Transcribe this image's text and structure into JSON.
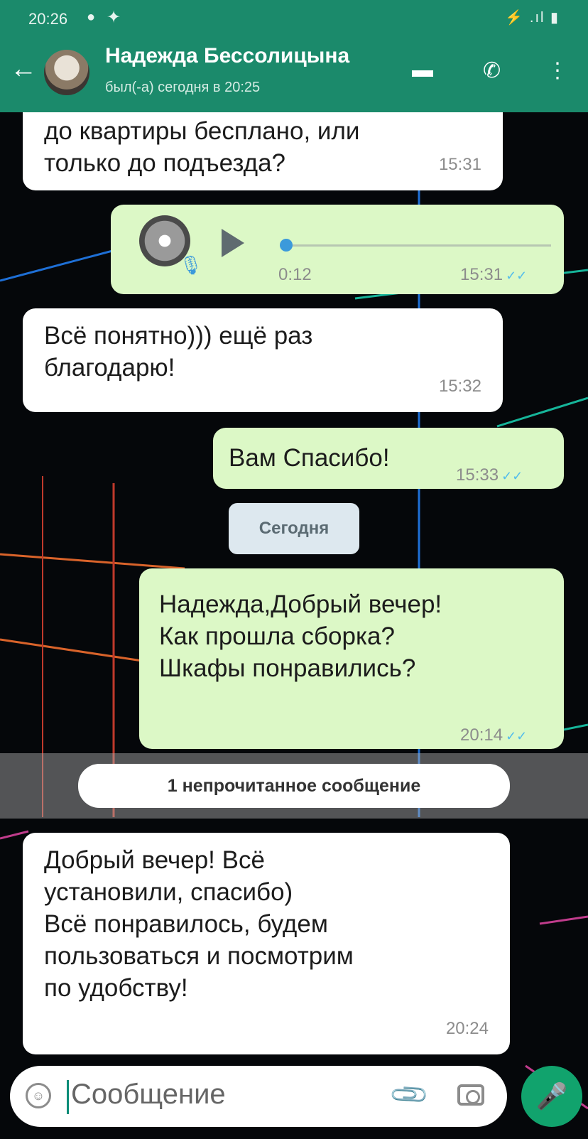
{
  "status_bar": {
    "time": "20:26",
    "icons": "⚡ .ıl ▮"
  },
  "header": {
    "contact_name": "Надежда Бессолицына",
    "last_seen": "был(-а) сегодня в 20:25",
    "back_icon": "arrow-left-icon",
    "video_icon": "video-camera-icon",
    "call_icon": "phone-icon",
    "menu_icon": "kebab-menu-icon",
    "accent_color": "#1b8a6b"
  },
  "messages": [
    {
      "direction": "in",
      "text": "до квартиры бесплано, или\nтолько до подъезда?",
      "time": "15:31"
    },
    {
      "direction": "out",
      "type": "voice",
      "duration": "0:12",
      "time": "15:31",
      "ticks": "✓✓"
    },
    {
      "direction": "in",
      "text": "Всё понятно))) ещё раз\nблагодарю!",
      "time": "15:32"
    },
    {
      "direction": "out",
      "text": "Вам Спасибо!",
      "time": "15:33",
      "ticks": "✓✓"
    },
    {
      "direction": "out",
      "text": "Надежда,Добрый вечер!\nКак прошла сборка?\nШкафы понравились?",
      "time": "20:14",
      "ticks": "✓✓"
    },
    {
      "direction": "in",
      "text": "Добрый вечер! Всё\nустановили, спасибо)\nВсё понравилось, будем\nпользоваться и посмотрим\nпо удобству!",
      "time": "20:24"
    }
  ],
  "date_chip": "Сегодня",
  "unread_label": "1 непрочитанное сообщение",
  "input": {
    "placeholder": "Сообщение"
  }
}
